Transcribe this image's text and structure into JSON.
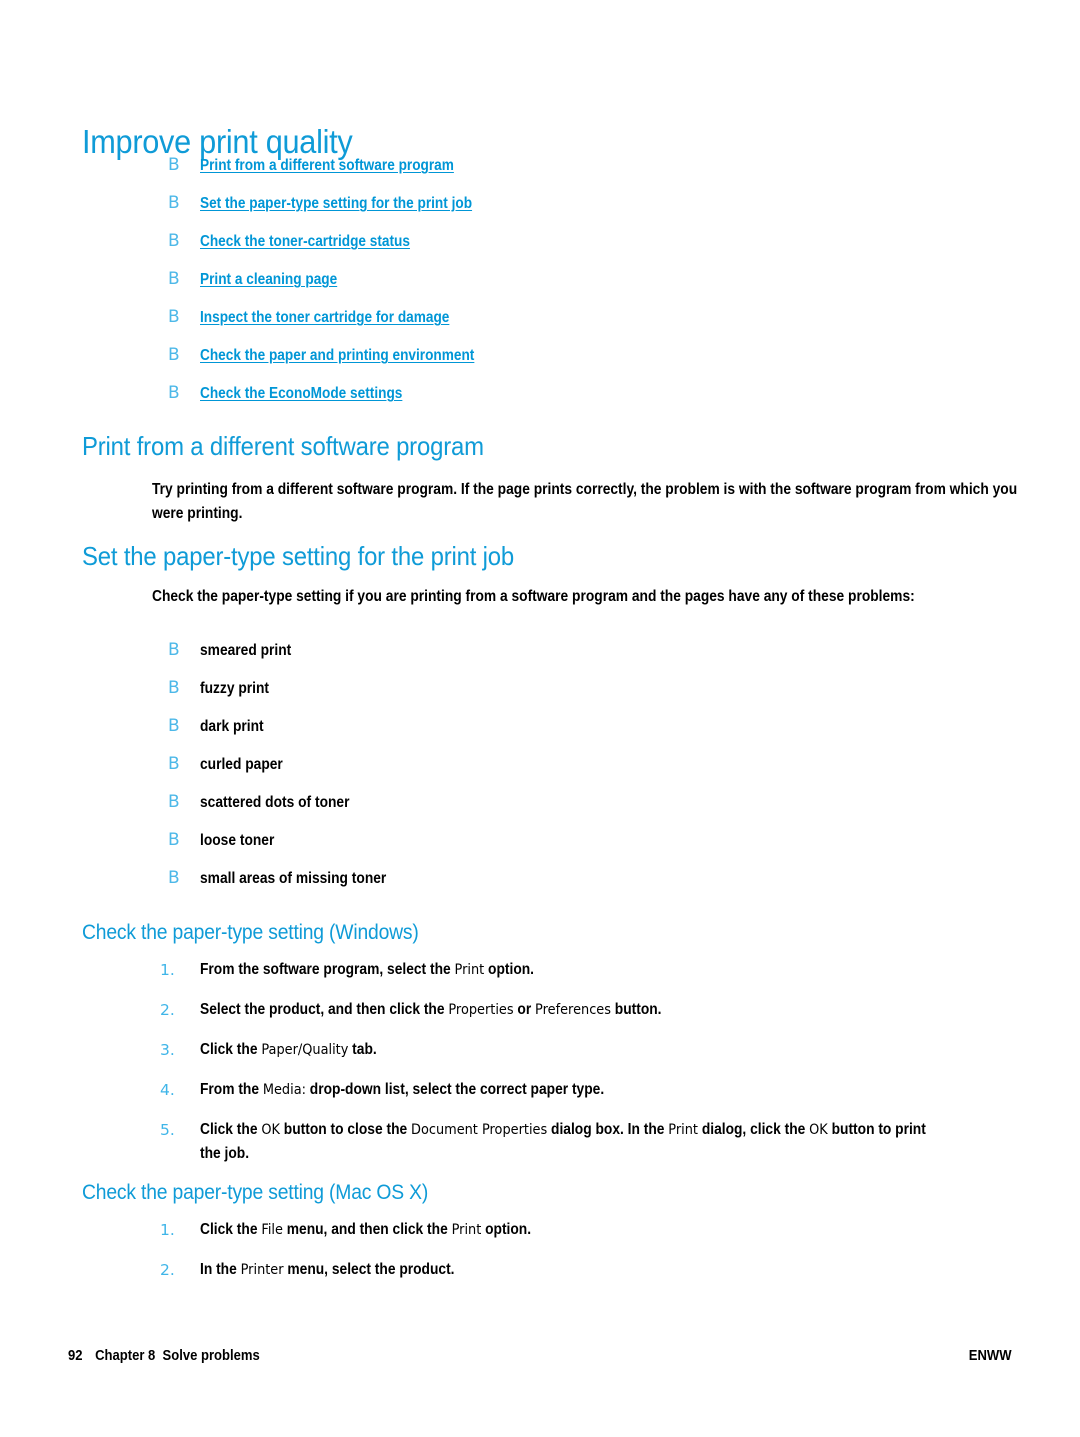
{
  "page": {
    "title": "Improve print quality",
    "background_color": "#ffffff",
    "heading_color": "#0f9bd7",
    "link_color": "#0096d6",
    "bullet_color": "#4db8e8",
    "number_color": "#3fb5e8"
  },
  "toc": {
    "bullet_glyph": "B",
    "items": [
      {
        "label": "Print from a different software program"
      },
      {
        "label": "Set the paper-type setting for the print job"
      },
      {
        "label": "Check the toner-cartridge status"
      },
      {
        "label": "Print a cleaning page"
      },
      {
        "label": "Inspect the toner cartridge for damage"
      },
      {
        "label": "Check the paper and printing environment"
      },
      {
        "label": "Check the EconoMode settings"
      }
    ]
  },
  "section1": {
    "heading": "Print from a different software program",
    "paragraph": "Try printing from a different software program. If the page prints correctly, the problem is with the software program from which you were printing."
  },
  "section2": {
    "heading": "Set the paper-type setting for the print job",
    "paragraph": "Check the paper-type setting if you are printing from a software program and the pages have any of these problems:",
    "bullet_glyph": "B",
    "problems": [
      {
        "label": "smeared print"
      },
      {
        "label": "fuzzy print"
      },
      {
        "label": "dark print"
      },
      {
        "label": "curled paper"
      },
      {
        "label": "scattered dots of toner"
      },
      {
        "label": "loose toner"
      },
      {
        "label": "small areas of missing toner"
      }
    ]
  },
  "windows": {
    "heading": "Check the paper-type setting (Windows)",
    "steps": [
      {
        "num": "1.",
        "parts": [
          {
            "t": "From the software program, select the ",
            "ui": false
          },
          {
            "t": "Print",
            "ui": true
          },
          {
            "t": " option.",
            "ui": false
          }
        ]
      },
      {
        "num": "2.",
        "parts": [
          {
            "t": "Select the product, and then click the ",
            "ui": false
          },
          {
            "t": "Properties",
            "ui": true
          },
          {
            "t": " or ",
            "ui": false
          },
          {
            "t": "Preferences",
            "ui": true
          },
          {
            "t": " button.",
            "ui": false
          }
        ]
      },
      {
        "num": "3.",
        "parts": [
          {
            "t": "Click the ",
            "ui": false
          },
          {
            "t": "Paper/Quality",
            "ui": true
          },
          {
            "t": " tab.",
            "ui": false
          }
        ]
      },
      {
        "num": "4.",
        "parts": [
          {
            "t": "From the ",
            "ui": false
          },
          {
            "t": "Media:",
            "ui": true
          },
          {
            "t": " drop-down list, select the correct paper type.",
            "ui": false
          }
        ]
      },
      {
        "num": "5.",
        "parts": [
          {
            "t": "Click the ",
            "ui": false
          },
          {
            "t": "OK",
            "ui": true
          },
          {
            "t": " button to close the ",
            "ui": false
          },
          {
            "t": "Document Properties",
            "ui": true
          },
          {
            "t": " dialog box. In the ",
            "ui": false
          },
          {
            "t": "Print",
            "ui": true
          },
          {
            "t": " dialog, click the ",
            "ui": false
          },
          {
            "t": "OK",
            "ui": true
          },
          {
            "t": " button to print the job.",
            "ui": false
          }
        ]
      }
    ]
  },
  "macosx": {
    "heading": "Check the paper-type setting (Mac OS X)",
    "steps": [
      {
        "num": "1.",
        "parts": [
          {
            "t": "Click the ",
            "ui": false
          },
          {
            "t": "File",
            "ui": true
          },
          {
            "t": " menu, and then click the ",
            "ui": false
          },
          {
            "t": "Print",
            "ui": true
          },
          {
            "t": " option.",
            "ui": false
          }
        ]
      },
      {
        "num": "2.",
        "parts": [
          {
            "t": "In the ",
            "ui": false
          },
          {
            "t": "Printer",
            "ui": true
          },
          {
            "t": " menu, select the product.",
            "ui": false
          }
        ]
      }
    ]
  },
  "footer": {
    "page_number": "92",
    "chapter": "Chapter 8",
    "chapter_title": "Solve problems",
    "right_label": "ENWW"
  }
}
